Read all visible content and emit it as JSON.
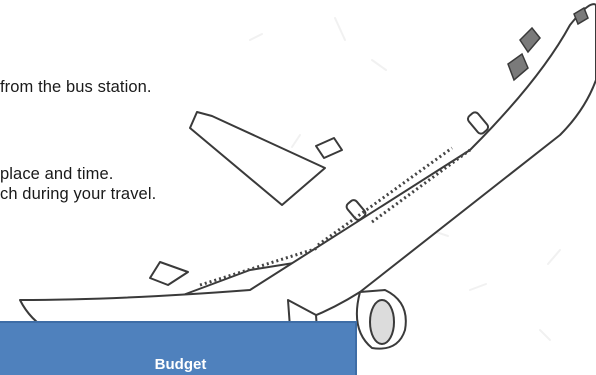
{
  "text_lines": [
    "from the bus station.",
    "place and time.",
    "ch during your travel."
  ],
  "table": {
    "header_label": "Budget"
  },
  "colors": {
    "table_header_bg": "#4f81bd",
    "text": "#1a1a1a"
  },
  "icons": {
    "airplane": "airplane-sketch-icon"
  }
}
